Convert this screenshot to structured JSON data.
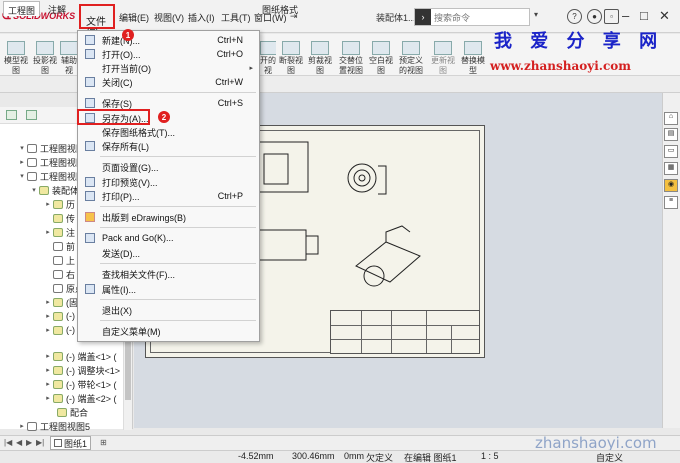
{
  "app": {
    "brand": "SOLIDWORKS",
    "doc_title": "装配体1...",
    "search_placeholder": "搜索命令"
  },
  "menubar": {
    "file": "文件(F)",
    "edit": "编辑(E)",
    "view": "视图(V)",
    "insert": "插入(I)",
    "tools": "工具(T)",
    "window": "窗口(W)",
    "pin": "⇥"
  },
  "command_manager": {
    "buttons": [
      "模型视图",
      "投影视图",
      "辅助视",
      "开的视",
      "断裂视图",
      "剪裁视图",
      "交替位置视图",
      "空白视图",
      "预定义的视图",
      "更新视图",
      "替换模型"
    ]
  },
  "tabs": {
    "drawing": "工程图",
    "annotation": "注解",
    "sheet_format": "图纸格式"
  },
  "watermark": {
    "title": "我 爱 分 享 网",
    "url": "www.zhanshaoyi.com",
    "bottom": "zhanshaoyi.com"
  },
  "file_menu": {
    "items": [
      {
        "label": "新建(N)...",
        "shortcut": "Ctrl+N"
      },
      {
        "label": "打开(O)...",
        "shortcut": "Ctrl+O"
      },
      {
        "label": "打开当前(O)",
        "submenu": "▸"
      },
      {
        "label": "关闭(C)",
        "shortcut": "Ctrl+W"
      },
      {
        "label": "保存(S)",
        "shortcut": "Ctrl+S"
      },
      {
        "label": "另存为(A)...",
        "shortcut": ""
      },
      {
        "label": "保存图纸格式(T)...",
        "shortcut": ""
      },
      {
        "label": "保存所有(L)",
        "shortcut": ""
      },
      {
        "label": "页面设置(G)...",
        "shortcut": ""
      },
      {
        "label": "打印预览(V)...",
        "shortcut": ""
      },
      {
        "label": "打印(P)...",
        "shortcut": "Ctrl+P"
      },
      {
        "label": "出版到 eDrawings(B)",
        "shortcut": ""
      },
      {
        "label": "Pack and Go(K)...",
        "shortcut": ""
      },
      {
        "label": "发送(D)...",
        "shortcut": ""
      },
      {
        "label": "查找相关文件(F)...",
        "shortcut": ""
      },
      {
        "label": "属性(I)...",
        "shortcut": ""
      },
      {
        "label": "退出(X)",
        "shortcut": ""
      },
      {
        "label": "自定义菜单(M)",
        "shortcut": ""
      }
    ],
    "badges": [
      "1",
      "2"
    ]
  },
  "tree": {
    "rows": [
      "工程图视图1",
      "工程图视图2",
      "工程图视图3",
      "装配体",
      "历",
      "传",
      "注",
      "前",
      "上",
      "右",
      "原点",
      "(固",
      "(-)",
      "(-)",
      "(-) 端盖<1> (",
      "(-) 调整块<1>",
      "(-) 带轮<1> (",
      "(-) 端盖<2> (",
      "配合",
      "工程图视图5"
    ]
  },
  "sheet_tabs": {
    "sheet1": "图纸1"
  },
  "status": {
    "x": "-4.52mm",
    "y": "300.46mm",
    "z": "0mm",
    "defined": "欠定义",
    "editing": "在编辑 图纸1",
    "scale": "1 : 5",
    "custom": "自定义"
  }
}
